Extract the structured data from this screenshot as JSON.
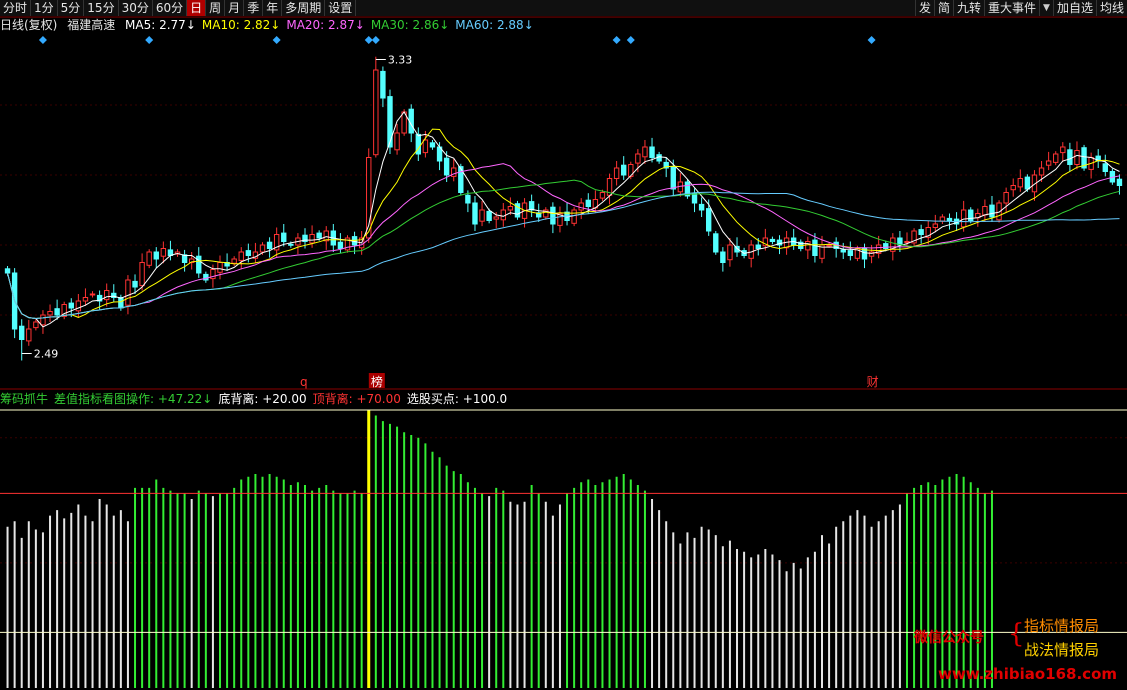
{
  "toolbar": {
    "tabs": [
      "分时",
      "1分",
      "5分",
      "15分",
      "30分",
      "60分",
      "日",
      "周",
      "月",
      "季",
      "年",
      "多周期",
      "设置"
    ],
    "active_tab": "日",
    "right_buttons": [
      "发",
      "简",
      "九转",
      "重大事件"
    ],
    "right_buttons_after": [
      "加自选",
      "均线"
    ]
  },
  "ma_legend": {
    "period_label": "日线(复权)",
    "stock_name": "福建高速",
    "items": [
      {
        "text": "MA5: 2.77↓",
        "color": "#ffffff"
      },
      {
        "text": "MA10: 2.82↓",
        "color": "#ffff00"
      },
      {
        "text": "MA20: 2.87↓",
        "color": "#ff66ff"
      },
      {
        "text": "MA30: 2.86↓",
        "color": "#33cc33"
      },
      {
        "text": "MA60: 2.88↓",
        "color": "#66ccff"
      }
    ]
  },
  "indicator_legend": {
    "items": [
      {
        "text": "筹码抓牛",
        "color": "#33cc33"
      },
      {
        "text": "差值指标看图操作: +47.22↓",
        "color": "#33cc33"
      },
      {
        "text": "底背离: +20.00",
        "color": "#ffffff"
      },
      {
        "text": "顶背离: +70.00",
        "color": "#ff3333"
      },
      {
        "text": "选股买点: +100.0",
        "color": "#ffffff"
      }
    ]
  },
  "chart_data": [
    {
      "type": "candlestick",
      "ylim": [
        2.4,
        3.4
      ],
      "price_labels": [
        {
          "text": "3.33",
          "index": 52,
          "value": 3.33
        },
        {
          "text": "2.49",
          "index": 2,
          "value": 2.49
        }
      ],
      "event_markers": [
        {
          "text": "q",
          "index": 42,
          "color": "#ff3333"
        },
        {
          "text": "榜",
          "index": 52,
          "color": "#ffffff",
          "bg": "#aa0000"
        },
        {
          "text": "财",
          "index": 122,
          "color": "#ff3333"
        }
      ],
      "diamond_markers": [
        5,
        20,
        38,
        51,
        52,
        86,
        88,
        122
      ],
      "colors": {
        "up": "#ff3333",
        "down": "#54ffff",
        "ma5": "#ffffff",
        "ma10": "#ffff00",
        "ma20": "#ff66ff",
        "ma30": "#33cc33",
        "ma60": "#66ccff"
      },
      "closes": [
        2.72,
        2.56,
        2.53,
        2.56,
        2.58,
        2.6,
        2.61,
        2.6,
        2.63,
        2.62,
        2.64,
        2.65,
        2.66,
        2.64,
        2.67,
        2.65,
        2.62,
        2.7,
        2.68,
        2.75,
        2.78,
        2.76,
        2.79,
        2.77,
        2.78,
        2.75,
        2.76,
        2.72,
        2.7,
        2.73,
        2.75,
        2.74,
        2.76,
        2.78,
        2.77,
        2.78,
        2.8,
        2.79,
        2.83,
        2.81,
        2.8,
        2.82,
        2.81,
        2.83,
        2.82,
        2.84,
        2.8,
        2.79,
        2.82,
        2.8,
        2.82,
        3.05,
        3.3,
        3.22,
        3.08,
        3.12,
        3.18,
        3.12,
        3.06,
        3.1,
        3.08,
        3.04,
        3.0,
        3.02,
        2.95,
        2.92,
        2.86,
        2.9,
        2.87,
        2.88,
        2.9,
        2.91,
        2.88,
        2.92,
        2.9,
        2.88,
        2.9,
        2.86,
        2.89,
        2.87,
        2.9,
        2.92,
        2.91,
        2.93,
        2.95,
        2.99,
        3.02,
        3.0,
        3.03,
        3.06,
        3.08,
        3.05,
        3.04,
        3.02,
        2.96,
        2.98,
        2.94,
        2.92,
        2.9,
        2.84,
        2.78,
        2.75,
        2.8,
        2.78,
        2.77,
        2.8,
        2.79,
        2.82,
        2.81,
        2.8,
        2.82,
        2.8,
        2.79,
        2.81,
        2.77,
        2.8,
        2.8,
        2.79,
        2.78,
        2.77,
        2.79,
        2.76,
        2.78,
        2.8,
        2.79,
        2.82,
        2.8,
        2.81,
        2.84,
        2.83,
        2.85,
        2.86,
        2.88,
        2.87,
        2.86,
        2.9,
        2.87,
        2.89,
        2.91,
        2.88,
        2.92,
        2.95,
        2.97,
        2.99,
        2.96,
        3.0,
        3.02,
        3.04,
        3.06,
        3.08,
        3.03,
        3.07,
        3.02,
        3.05,
        3.04,
        3.01,
        2.98,
        2.97
      ]
    },
    {
      "type": "bar",
      "ylim": [
        0,
        100
      ],
      "reference_lines": [
        {
          "value": 20,
          "color": "#ffffcc"
        },
        {
          "value": 70,
          "color": "#ff3333"
        },
        {
          "value": 100,
          "color": "#ffffcc"
        }
      ],
      "highlight_index": 51,
      "colors": {
        "above": "#33ee33",
        "below": "#e6e6e6",
        "highlight": "#ffff00"
      },
      "values": [
        58,
        60,
        54,
        60,
        57,
        56,
        62,
        64,
        61,
        63,
        66,
        62,
        60,
        68,
        66,
        62,
        64,
        60,
        72,
        72,
        72,
        75,
        72,
        71,
        70,
        70,
        68,
        71,
        70,
        69,
        70,
        70,
        72,
        75,
        76,
        77,
        76,
        77,
        76,
        75,
        73,
        74,
        73,
        71,
        72,
        73,
        71,
        70,
        70,
        71,
        70,
        100,
        98,
        96,
        95,
        94,
        92,
        91,
        90,
        88,
        85,
        83,
        80,
        78,
        77,
        74,
        72,
        70,
        69,
        72,
        71,
        67,
        66,
        67,
        73,
        70,
        67,
        62,
        66,
        70,
        72,
        74,
        75,
        73,
        74,
        75,
        76,
        77,
        75,
        73,
        71,
        68,
        64,
        60,
        56,
        52,
        56,
        54,
        58,
        57,
        55,
        51,
        53,
        50,
        49,
        47,
        48,
        50,
        48,
        46,
        42,
        45,
        43,
        47,
        49,
        55,
        52,
        58,
        60,
        62,
        64,
        62,
        58,
        60,
        62,
        64,
        66,
        70,
        72,
        73,
        74,
        73,
        75,
        76,
        77,
        76,
        74,
        72,
        70,
        71
      ]
    }
  ],
  "watermark": {
    "left": "微信公众号",
    "right_top": "指标情报局",
    "right_bottom": "战法情报局",
    "url": "www.zhibiao168.com"
  }
}
